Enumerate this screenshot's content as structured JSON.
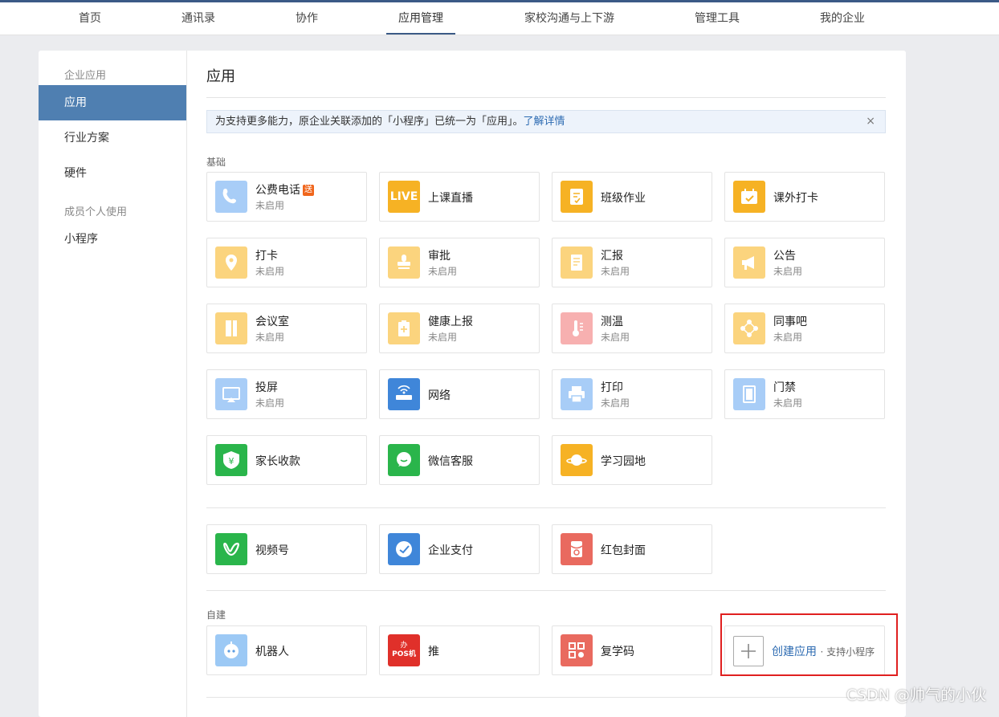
{
  "nav": {
    "items": [
      "首页",
      "通讯录",
      "协作",
      "应用管理",
      "家校沟通与上下游",
      "管理工具",
      "我的企业"
    ],
    "active_index": 3
  },
  "sidebar": {
    "group1": "企业应用",
    "items1": [
      "应用",
      "行业方案",
      "硬件"
    ],
    "group2": "成员个人使用",
    "items2": [
      "小程序"
    ],
    "active": "应用"
  },
  "main": {
    "title": "应用",
    "notice": {
      "text": "为支持更多能力，原企业关联添加的「小程序」已统一为「应用」。",
      "link": "了解详情",
      "close": "×"
    },
    "section_basic": "基础",
    "section_custom": "自建",
    "basic_apps": [
      {
        "name": "公费电话",
        "status": "未启用",
        "badge": "送",
        "icon": "phone-icon",
        "color": "#a8cdf7"
      },
      {
        "name": "上课直播",
        "status": "",
        "icon": "live-icon",
        "icon_text": "LIVE",
        "color": "#f6b224"
      },
      {
        "name": "班级作业",
        "status": "",
        "icon": "homework-icon",
        "color": "#f6b224"
      },
      {
        "name": "课外打卡",
        "status": "",
        "icon": "calendar-check-icon",
        "color": "#f6b224"
      },
      {
        "name": "打卡",
        "status": "未启用",
        "icon": "location-pin-icon",
        "color": "#fbd47e"
      },
      {
        "name": "审批",
        "status": "未启用",
        "icon": "stamp-icon",
        "color": "#fbd47e"
      },
      {
        "name": "汇报",
        "status": "未启用",
        "icon": "report-icon",
        "color": "#fbd47e"
      },
      {
        "name": "公告",
        "status": "未启用",
        "icon": "megaphone-icon",
        "color": "#fbd47e"
      },
      {
        "name": "会议室",
        "status": "未启用",
        "icon": "door-icon",
        "color": "#fbd47e"
      },
      {
        "name": "健康上报",
        "status": "未启用",
        "icon": "clipboard-plus-icon",
        "color": "#fbd47e"
      },
      {
        "name": "测温",
        "status": "未启用",
        "icon": "thermometer-icon",
        "color": "#f7b0b0"
      },
      {
        "name": "同事吧",
        "status": "未启用",
        "icon": "network-icon",
        "color": "#fbd47e"
      },
      {
        "name": "投屏",
        "status": "未启用",
        "icon": "airplay-icon",
        "color": "#a8cdf7"
      },
      {
        "name": "网络",
        "status": "",
        "icon": "router-icon",
        "color": "#3f86d9"
      },
      {
        "name": "打印",
        "status": "未启用",
        "icon": "printer-icon",
        "color": "#a8cdf7"
      },
      {
        "name": "门禁",
        "status": "未启用",
        "icon": "door-access-icon",
        "color": "#a8cdf7"
      },
      {
        "name": "家长收款",
        "status": "",
        "icon": "yuan-shield-icon",
        "color": "#2ab54b"
      },
      {
        "name": "微信客服",
        "status": "",
        "icon": "chat-bubble-icon",
        "color": "#2ab54b"
      },
      {
        "name": "学习园地",
        "status": "",
        "icon": "planet-icon",
        "color": "#f6b224"
      }
    ],
    "extra_apps": [
      {
        "name": "视频号",
        "status": "",
        "icon": "channels-icon",
        "color": "#2ab54b"
      },
      {
        "name": "企业支付",
        "status": "",
        "icon": "pay-icon",
        "color": "#3f86d9"
      },
      {
        "name": "红包封面",
        "status": "",
        "icon": "red-packet-icon",
        "color": "#e96a5f"
      }
    ],
    "custom_apps": [
      {
        "name": "机器人",
        "status": "",
        "icon": "robot-icon",
        "color": "#9cc9f5"
      },
      {
        "name": "推",
        "status": "",
        "icon": "pos-icon",
        "icon_text": "POS机",
        "icon_top": "办",
        "color": "#e0302a"
      },
      {
        "name": "复学码",
        "status": "",
        "icon": "qr-code-icon",
        "color": "#e96a5f"
      }
    ],
    "create": {
      "label": "创建应用",
      "sub": "· 支持小程序"
    }
  },
  "watermark": "CSDN @帅气的小伙"
}
